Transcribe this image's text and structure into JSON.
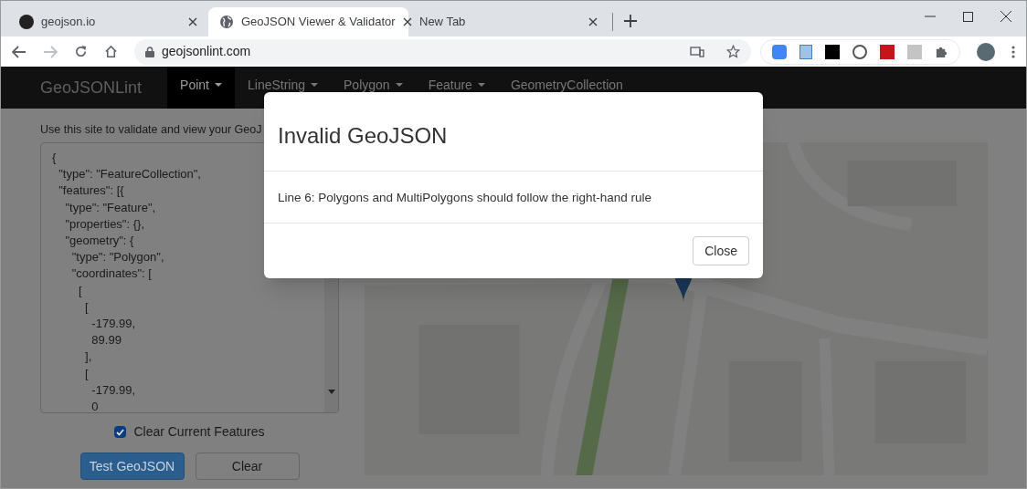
{
  "browser": {
    "tabs": [
      {
        "title": "geojson.io",
        "selected": false
      },
      {
        "title": "GeoJSON Viewer & Validator",
        "selected": true
      },
      {
        "title": "New Tab",
        "selected": false
      }
    ],
    "url": "geojsonlint.com"
  },
  "navbar": {
    "brand": "GeoJSONLint",
    "items": [
      {
        "label": "Point",
        "dropdown": true,
        "selected": true
      },
      {
        "label": "LineString",
        "dropdown": true,
        "selected": false
      },
      {
        "label": "Polygon",
        "dropdown": true,
        "selected": false
      },
      {
        "label": "Feature",
        "dropdown": true,
        "selected": false
      },
      {
        "label": "GeometryCollection",
        "dropdown": false,
        "selected": false
      }
    ]
  },
  "intro": "Use this site to validate and view your GeoJ",
  "editor": {
    "value": "{\n  \"type\": \"FeatureCollection\",\n  \"features\": [{\n    \"type\": \"Feature\",\n    \"properties\": {},\n    \"geometry\": {\n      \"type\": \"Polygon\",\n      \"coordinates\": [\n        [\n          [\n            -179.99,\n            89.99\n          ],\n          [\n            -179.99,\n            0"
  },
  "clear_features": {
    "label": "Clear Current Features",
    "checked": true
  },
  "buttons": [
    "Test GeoJSON",
    "Clear"
  ],
  "map": {
    "kind": "picture"
  },
  "modal": {
    "title": "Invalid GeoJSON",
    "message": "Line 6: Polygons and MultiPolygons should follow the right-hand rule",
    "button": "Close"
  }
}
